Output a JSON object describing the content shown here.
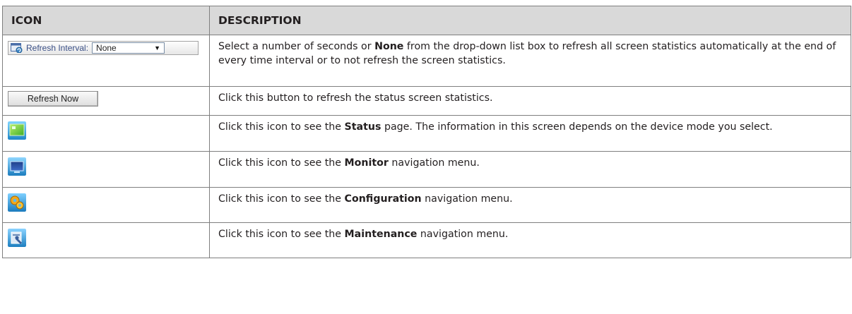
{
  "caption_fragment": "",
  "table": {
    "headers": {
      "icon": "ICON",
      "description": "DESCRIPTION"
    },
    "rows": [
      {
        "icon_name": "refresh-interval-selector",
        "widget": {
          "label": "Refresh Interval:",
          "selected": "None"
        },
        "desc": {
          "a": "Select a number of seconds or ",
          "b": "None",
          "c": " from the drop-down list box to refresh all screen statistics automatically at the end of every time interval or to not refresh the screen statistics."
        }
      },
      {
        "icon_name": "refresh-now-button",
        "widget": {
          "label": "Refresh Now"
        },
        "desc": {
          "a": "Click this button to refresh the status screen statistics."
        }
      },
      {
        "icon_name": "status-icon",
        "desc": {
          "a": "Click this icon to see the ",
          "b": "Status",
          "c": " page. The information in this screen depends on the device mode you select."
        }
      },
      {
        "icon_name": "monitor-icon",
        "desc": {
          "a": "Click this icon to see the ",
          "b": "Monitor",
          "c": " navigation menu."
        }
      },
      {
        "icon_name": "configuration-icon",
        "desc": {
          "a": "Click this icon to see the ",
          "b": "Configuration",
          "c": " navigation menu."
        }
      },
      {
        "icon_name": "maintenance-icon",
        "desc": {
          "a": "Click this icon to see the ",
          "b": "Maintenance",
          "c": " navigation menu."
        }
      }
    ]
  },
  "colors": {
    "header_bg": "#d9d9d9",
    "border": "#7f7f7f",
    "text": "#231f20",
    "widget_text": "#3a4f86"
  }
}
